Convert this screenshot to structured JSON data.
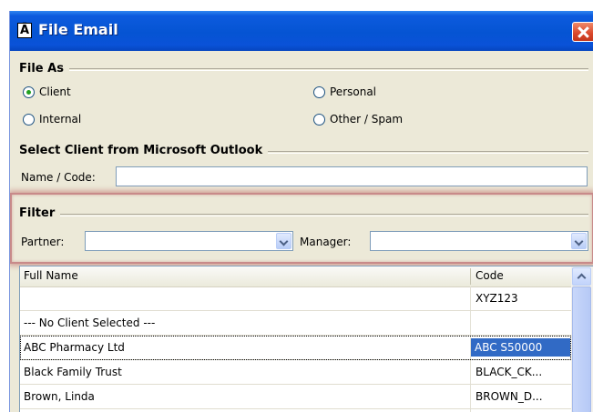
{
  "window": {
    "title": "File Email",
    "app_icon_glyph": "Ā",
    "close_icon": "close-icon"
  },
  "file_as": {
    "group_label": "File As",
    "options": [
      {
        "label": "Client",
        "checked": true
      },
      {
        "label": "Personal",
        "checked": false
      },
      {
        "label": "Internal",
        "checked": false
      },
      {
        "label": "Other / Spam",
        "checked": false
      }
    ]
  },
  "select_client": {
    "group_label": "Select Client from Microsoft Outlook",
    "name_code_label": "Name / Code:",
    "name_code_value": ""
  },
  "filter": {
    "group_label": "Filter",
    "partner_label": "Partner:",
    "partner_value": "",
    "manager_label": "Manager:",
    "manager_value": ""
  },
  "list": {
    "columns": [
      "Full Name",
      "Code"
    ],
    "rows": [
      {
        "full_name": "",
        "code": "XYZ123"
      },
      {
        "full_name": "--- No Client Selected ---",
        "code": ""
      },
      {
        "full_name": "ABC Pharmacy  Ltd",
        "code": "ABC S50000",
        "selected": true
      },
      {
        "full_name": "Black Family Trust",
        "code": "BLACK_CK..."
      },
      {
        "full_name": "Brown, Linda",
        "code": "BROWN_D..."
      }
    ]
  },
  "colors": {
    "title_bar": "#0554d3",
    "dialog_bg": "#ece9d8",
    "selection": "#316ac5",
    "filter_highlight": "#c88a8a"
  }
}
